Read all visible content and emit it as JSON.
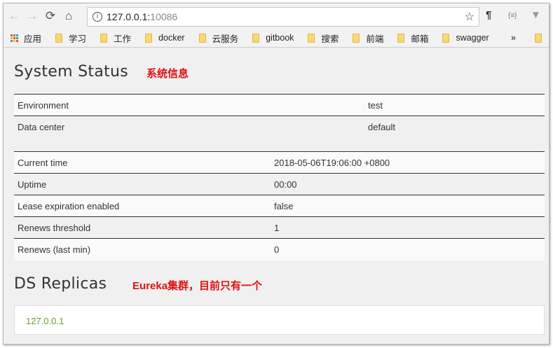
{
  "browser": {
    "url_host": "127.0.0.1:",
    "url_port": "10086",
    "bookmarks": [
      "应用",
      "学习",
      "工作",
      "docker",
      "云服务",
      "gitbook",
      "搜索",
      "前端",
      "邮箱",
      "swagger"
    ],
    "overflow": "»"
  },
  "system_status": {
    "title": "System Status",
    "annotation": "系统信息",
    "env_rows": [
      {
        "label": "Environment",
        "value": "test"
      },
      {
        "label": "Data center",
        "value": "default"
      }
    ],
    "status_rows": [
      {
        "label": "Current time",
        "value": "2018-05-06T19:06:00 +0800"
      },
      {
        "label": "Uptime",
        "value": "00:00"
      },
      {
        "label": "Lease expiration enabled",
        "value": "false"
      },
      {
        "label": "Renews threshold",
        "value": "1"
      },
      {
        "label": "Renews (last min)",
        "value": "0"
      }
    ]
  },
  "ds_replicas": {
    "title": "DS Replicas",
    "annotation": "Eureka集群，目前只有一个",
    "items": [
      "127.0.0.1"
    ]
  }
}
